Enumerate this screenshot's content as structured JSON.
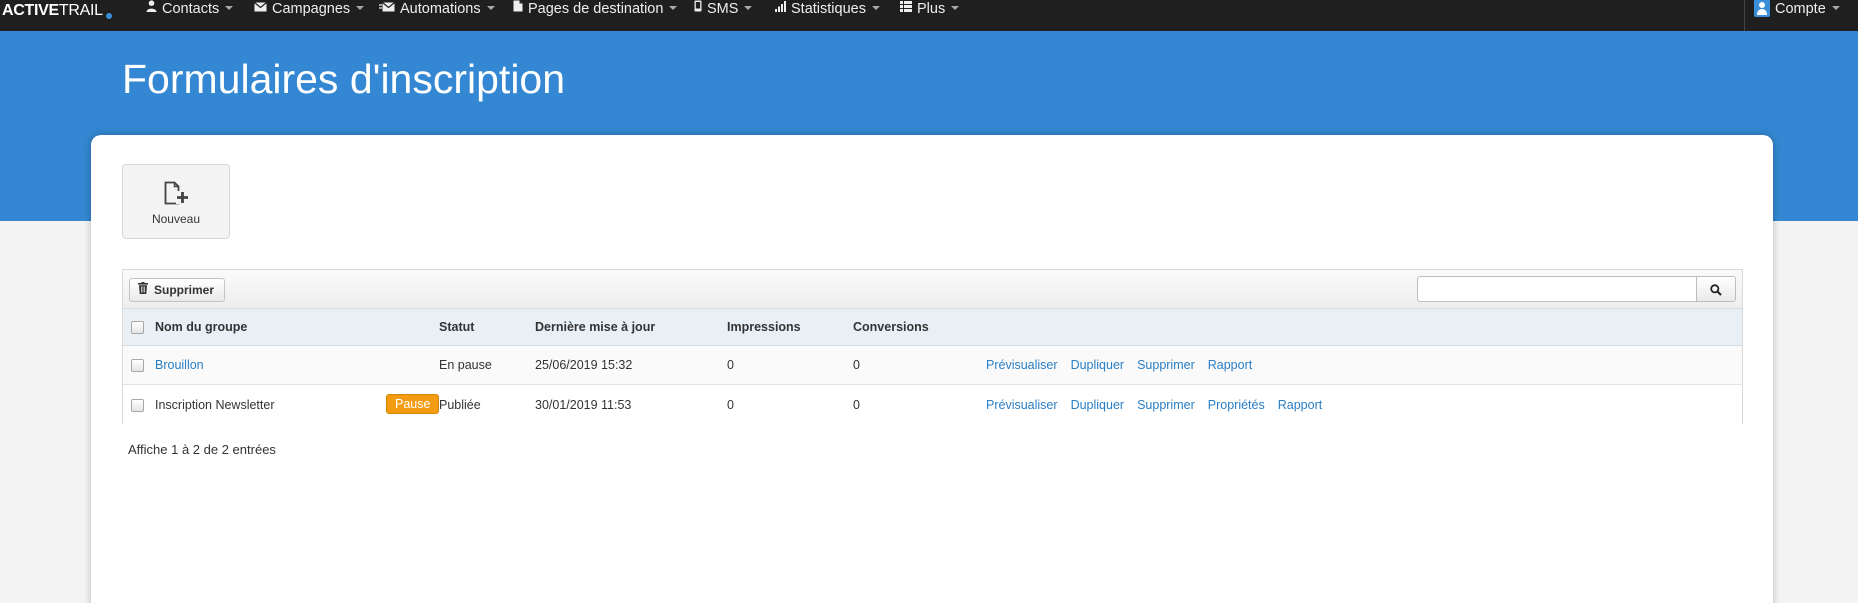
{
  "nav": {
    "logo_bold": "ACTIVE",
    "logo_light": "TRAIL",
    "items": [
      {
        "label": "Contacts",
        "icon": "user-icon"
      },
      {
        "label": "Campagnes",
        "icon": "envelope-icon"
      },
      {
        "label": "Automations",
        "icon": "automation-envelope-icon"
      },
      {
        "label": "Pages de destination",
        "icon": "page-icon"
      },
      {
        "label": "SMS",
        "icon": "mobile-icon"
      },
      {
        "label": "Statistiques",
        "icon": "signal-bars-icon"
      },
      {
        "label": "Plus",
        "icon": "list-icon"
      }
    ],
    "account": {
      "label": "Compte",
      "icon": "user-avatar-icon"
    }
  },
  "page": {
    "title": "Formulaires d'inscription",
    "banner_color": "#3487d2"
  },
  "new_button": {
    "label": "Nouveau",
    "icon": "new-file-icon"
  },
  "toolbar": {
    "delete_label": "Supprimer",
    "delete_icon": "trash-icon",
    "search_value": "",
    "search_icon": "search-icon"
  },
  "table": {
    "columns": [
      "Nom du groupe",
      "Statut",
      "Dernière mise à jour",
      "Impressions",
      "Conversions"
    ],
    "rows": [
      {
        "name": "Brouillon",
        "name_is_link": true,
        "badge": "",
        "status": "En pause",
        "updated": "25/06/2019 15:32",
        "impressions": "0",
        "conversions": "0",
        "actions": [
          "Prévisualiser",
          "Dupliquer",
          "Supprimer",
          "Rapport"
        ]
      },
      {
        "name": "Inscription Newsletter",
        "name_is_link": false,
        "badge": "Pause",
        "status": "Publiée",
        "updated": "30/01/2019 11:53",
        "impressions": "0",
        "conversions": "0",
        "actions": [
          "Prévisualiser",
          "Dupliquer",
          "Supprimer",
          "Propriétés",
          "Rapport"
        ]
      }
    ]
  },
  "footer_info": "Affiche 1 à 2 de 2 entrées",
  "colors": {
    "link": "#2a7ec4",
    "badge": "#f39c12",
    "nav_bg": "#1f1f1f"
  }
}
